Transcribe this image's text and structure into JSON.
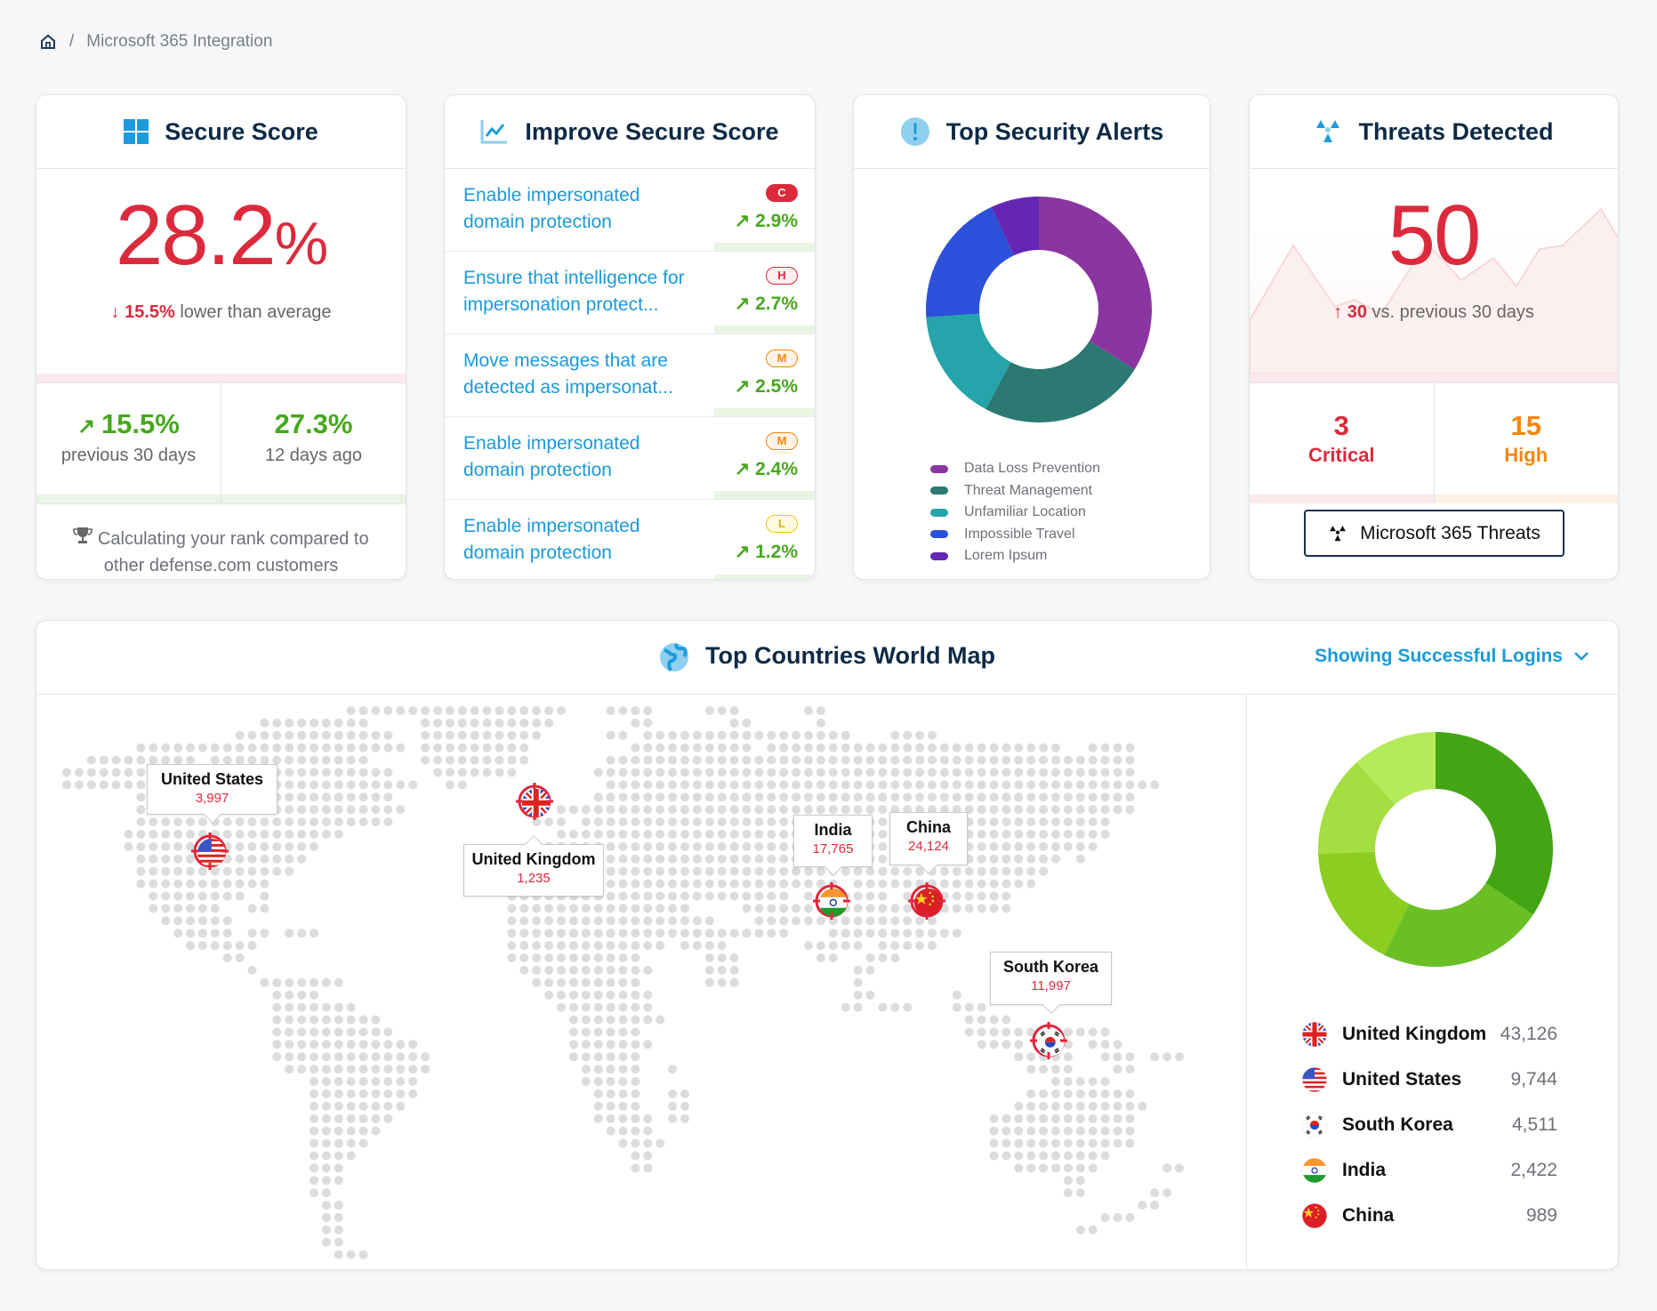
{
  "breadcrumb": {
    "home_icon": "home-icon",
    "separator": "/",
    "current": "Microsoft 365 Integration"
  },
  "secure_score": {
    "title": "Secure Score",
    "value": "28.2",
    "unit": "%",
    "delta": "15.5%",
    "delta_text": "lower than average",
    "stats": [
      {
        "value": "15.5%",
        "label": "previous 30 days"
      },
      {
        "value": "27.3%",
        "label": "12 days ago"
      }
    ],
    "rank_text": "Calculating your rank compared to other defense.com customers"
  },
  "improve": {
    "title": "Improve Secure Score",
    "items": [
      {
        "text": "Enable impersonated domain protection",
        "severity": "C",
        "change": "2.9%"
      },
      {
        "text": "Ensure that intelligence for impersonation protect...",
        "severity": "H",
        "change": "2.7%"
      },
      {
        "text": "Move messages that are detected as impersonat...",
        "severity": "M",
        "change": "2.5%"
      },
      {
        "text": "Enable impersonated domain protection",
        "severity": "M",
        "change": "2.4%"
      },
      {
        "text": "Enable impersonated domain protection",
        "severity": "L",
        "change": "1.2%"
      }
    ]
  },
  "alerts": {
    "title": "Top Security Alerts"
  },
  "threats": {
    "title": "Threats Detected",
    "value": "50",
    "delta": "30",
    "delta_text": "vs. previous 30 days",
    "critical": {
      "value": "3",
      "label": "Critical"
    },
    "high": {
      "value": "15",
      "label": "High"
    },
    "button": "Microsoft 365 Threats"
  },
  "map": {
    "title": "Top Countries World Map",
    "filter": "Showing Successful Logins",
    "markers": [
      {
        "country": "United States",
        "value": "3,997",
        "flag": "us"
      },
      {
        "country": "United Kingdom",
        "value": "1,235",
        "flag": "uk"
      },
      {
        "country": "India",
        "value": "17,765",
        "flag": "in"
      },
      {
        "country": "China",
        "value": "24,124",
        "flag": "cn"
      },
      {
        "country": "South Korea",
        "value": "11,997",
        "flag": "kr"
      }
    ]
  },
  "chart_data": [
    {
      "type": "pie",
      "donut": true,
      "categories": [
        "Data Loss Prevention",
        "Threat Management",
        "Unfamiliar Location",
        "Impossible Travel",
        "Lorem Ipsum"
      ],
      "values": [
        33.9,
        23.9,
        16.1,
        19.2,
        6.9
      ],
      "colors": [
        "#8a35a0",
        "#2c7873",
        "#25a4ab",
        "#2b50d9",
        "#6526b3"
      ],
      "legend": "bottom"
    },
    {
      "type": "pie",
      "donut": true,
      "categories": [
        "United Kingdom",
        "United States",
        "South Korea",
        "India",
        "China"
      ],
      "values": [
        43126,
        9744,
        4511,
        2422,
        989
      ],
      "labels": [
        "43,126",
        "9,744",
        "4,511",
        "2,422",
        "989"
      ],
      "flags": [
        "uk",
        "us",
        "kr",
        "in",
        "cn"
      ],
      "arc_shares_percent": [
        34.4,
        22.8,
        17.2,
        13.9,
        11.7
      ],
      "colors": [
        "#43a513",
        "#6abf24",
        "#8ccd22",
        "#a4de40",
        "#b5ea5a"
      ],
      "legend": "bottom"
    }
  ]
}
